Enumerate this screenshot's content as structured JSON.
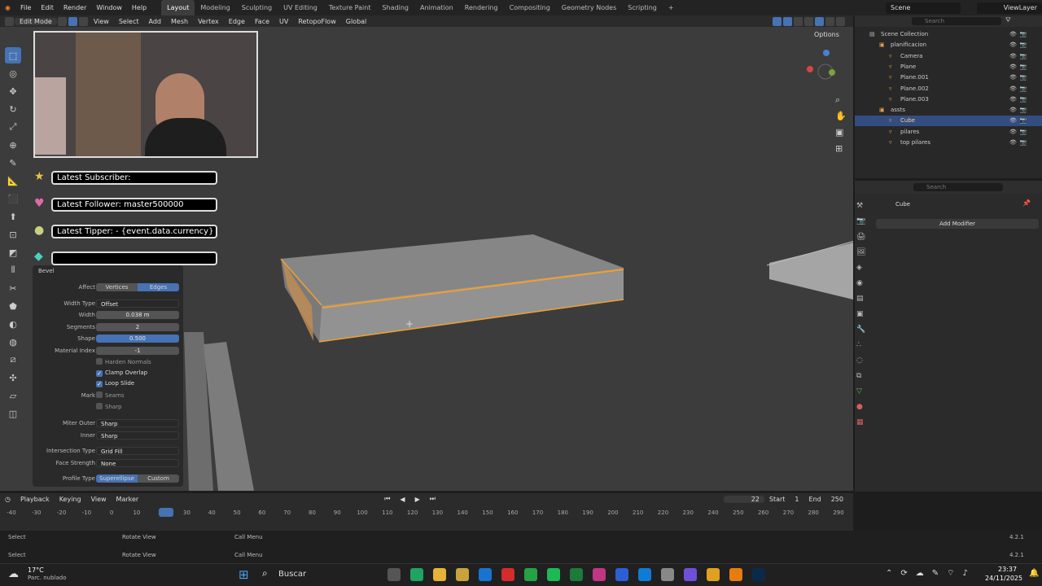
{
  "menu": [
    "File",
    "Edit",
    "Render",
    "Window",
    "Help"
  ],
  "workspaces": [
    "Layout",
    "Modeling",
    "Sculpting",
    "UV Editing",
    "Texture Paint",
    "Shading",
    "Animation",
    "Rendering",
    "Compositing",
    "Geometry Nodes",
    "Scripting",
    "+"
  ],
  "scene": "Scene",
  "view_layer": "ViewLayer",
  "header": {
    "mode": "Edit Mode",
    "view": "View",
    "select": "Select",
    "add": "Add",
    "mesh": "Mesh",
    "vertex": "Vertex",
    "edge": "Edge",
    "face": "Face",
    "uv": "UV",
    "retopoflow": "RetopoFlow",
    "orientation": "Global",
    "options": "Options"
  },
  "overlay": {
    "subscriber": "Latest Subscriber:",
    "follower": "Latest Follower: master500000",
    "tipper": "Latest Tipper:  - {event.data.currency} 0",
    "blank": ""
  },
  "bevel": {
    "title": "Bevel",
    "affect_label": "Affect",
    "affect_options": [
      "Vertices",
      "Edges"
    ],
    "width_type_label": "Width Type",
    "width_type": "Offset",
    "width_label": "Width",
    "width": "0.038 m",
    "segments_label": "Segments",
    "segments": "2",
    "shape_label": "Shape",
    "shape": "0.500",
    "material_index_label": "Material Index",
    "material_index": "-1",
    "harden_normals": "Harden Normals",
    "clamp_overlap": "Clamp Overlap",
    "loop_slide": "Loop Slide",
    "mark_label": "Mark",
    "seams": "Seams",
    "sharp": "Sharp",
    "miter_outer_label": "Miter Outer",
    "miter_outer": "Sharp",
    "inner_label": "Inner",
    "inner": "Sharp",
    "intersection_type_label": "Intersection Type",
    "intersection_type": "Grid Fill",
    "face_strength_label": "Face Strength",
    "face_strength": "None",
    "profile_type_label": "Profile Type",
    "profile_type_options": [
      "Superellipse",
      "Custom"
    ]
  },
  "outliner": {
    "search": "Search",
    "items": [
      {
        "label": "Scene Collection",
        "depth": 0
      },
      {
        "label": "planificacion",
        "depth": 1
      },
      {
        "label": "Camera",
        "depth": 2
      },
      {
        "label": "Plane",
        "depth": 2
      },
      {
        "label": "Plane.001",
        "depth": 2
      },
      {
        "label": "Plane.002",
        "depth": 2
      },
      {
        "label": "Plane.003",
        "depth": 2
      },
      {
        "label": "assts",
        "depth": 1
      },
      {
        "label": "Cube",
        "depth": 2,
        "selected": true
      },
      {
        "label": "pilares",
        "depth": 2
      },
      {
        "label": "top pilares",
        "depth": 2
      }
    ]
  },
  "properties": {
    "search": "Search",
    "object": "Cube",
    "add_modifier": "Add Modifier"
  },
  "timeline": {
    "playback": "Playback",
    "keying": "Keying",
    "view": "View",
    "marker": "Marker",
    "current_frame": "22",
    "start_label": "Start",
    "start": "1",
    "end_label": "End",
    "end": "250",
    "ticks": [
      "-40",
      "-30",
      "-20",
      "-10",
      "0",
      "10",
      "20",
      "30",
      "40",
      "50",
      "60",
      "70",
      "80",
      "90",
      "100",
      "110",
      "120",
      "130",
      "140",
      "150",
      "160",
      "170",
      "180",
      "190",
      "200",
      "210",
      "220",
      "230",
      "240",
      "250",
      "260",
      "270",
      "280",
      "290"
    ]
  },
  "status": {
    "select": "Select",
    "rotate": "Rotate View",
    "call_menu": "Call Menu",
    "version": "4.2.1"
  },
  "taskbar": {
    "temperature": "17°C",
    "weather": "Parc. nublado",
    "search": "Buscar",
    "time": "23:37",
    "date": "24/11/2025"
  },
  "colors": {
    "accent": "#4772b3",
    "selection": "#f0a030",
    "viewport": "#3c3c3c"
  }
}
